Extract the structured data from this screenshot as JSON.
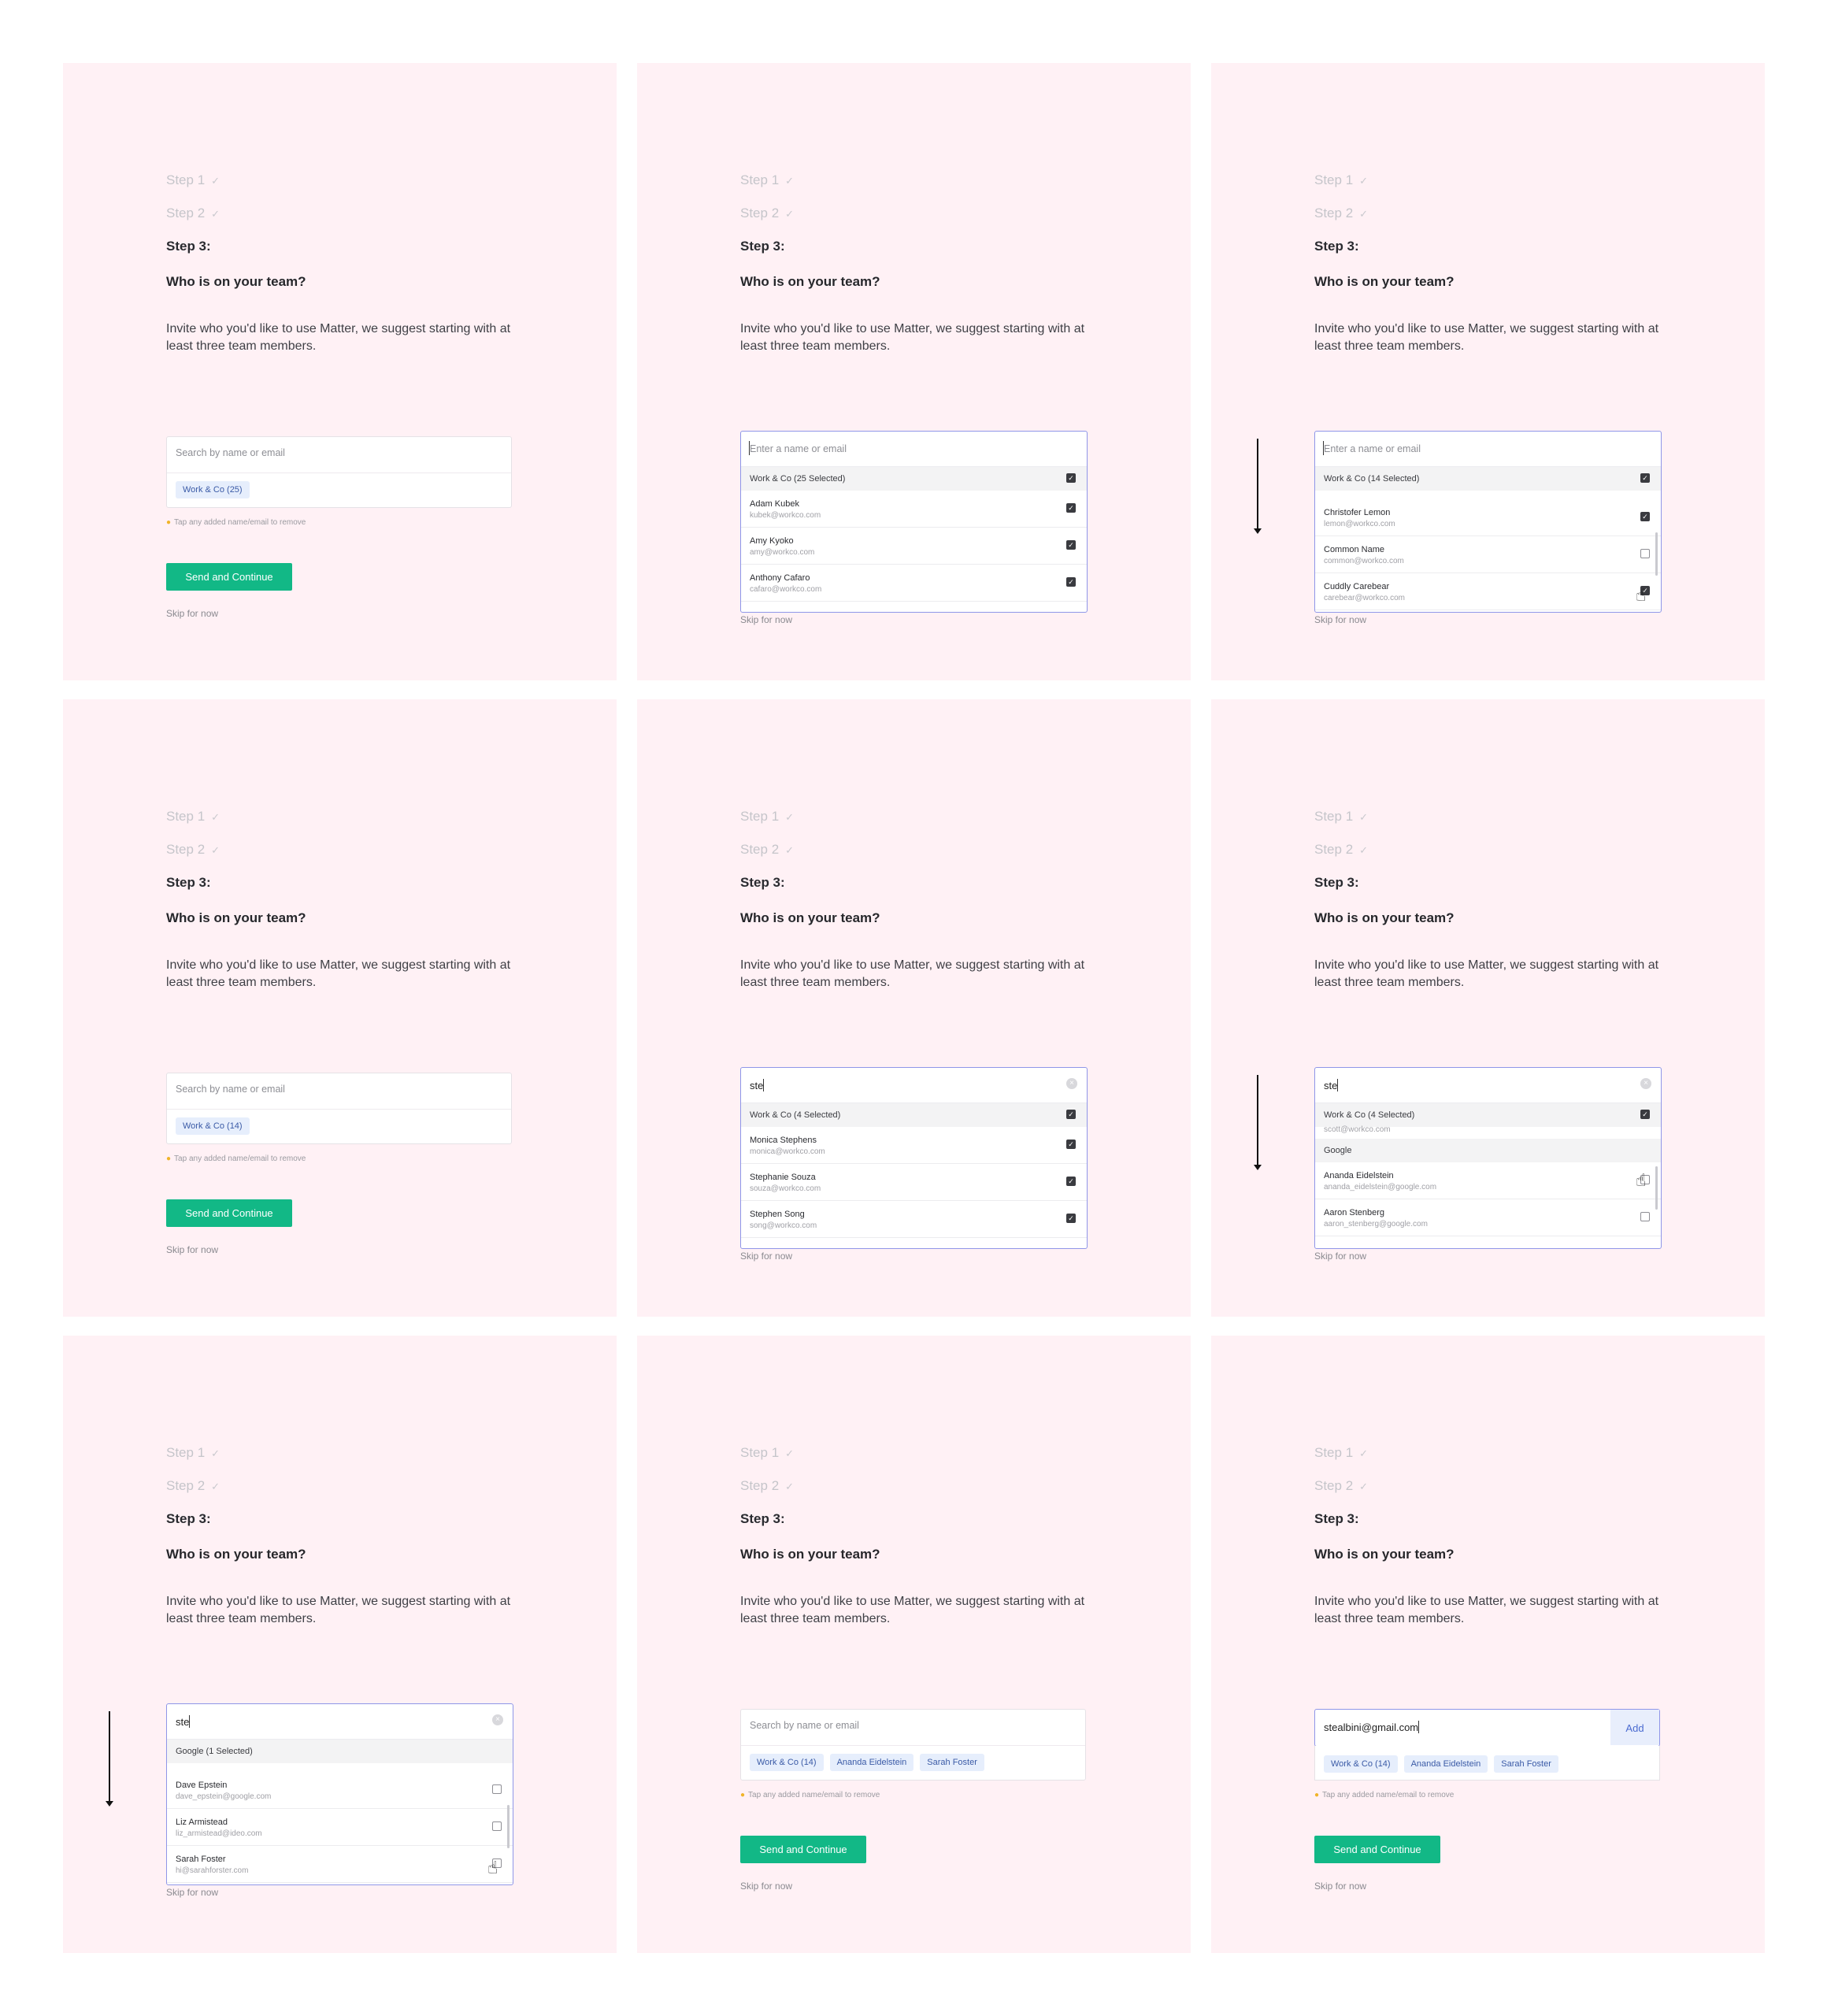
{
  "common": {
    "step1": "Step 1",
    "step2": "Step 2",
    "step3": "Step 3:",
    "check": "✓",
    "question": "Who is on your team?",
    "description": "Invite who you'd like to use Matter, we suggest starting with at least three team members.",
    "search_placeholder": "Search by name or email",
    "dropdown_placeholder": "Enter a name or email",
    "hint": "Tap any added name/email to remove",
    "send_button": "Send and Continue",
    "skip_link": "Skip for now",
    "typed_query": "ste",
    "add_button": "Add",
    "typed_email": "stealbini@gmail.com"
  },
  "panels": {
    "p1": {
      "chips": [
        "Work & Co (25)"
      ]
    },
    "p2": {
      "group": "Work & Co (25 Selected)",
      "options": [
        {
          "name": "Adam Kubek",
          "email": "kubek@workco.com",
          "checked": true
        },
        {
          "name": "Amy Kyoko",
          "email": "amy@workco.com",
          "checked": true
        },
        {
          "name": "Anthony Cafaro",
          "email": "cafaro@workco.com",
          "checked": true
        }
      ]
    },
    "p3": {
      "group": "Work & Co (14 Selected)",
      "options": [
        {
          "name": "Christofer Lemon",
          "email": "lemon@workco.com",
          "checked": true
        },
        {
          "name": "Common Name",
          "email": "common@workco.com",
          "checked": false
        },
        {
          "name": "Cuddly Carebear",
          "email": "carebear@workco.com",
          "checked": true
        }
      ]
    },
    "p4": {
      "chips": [
        "Work & Co (14)"
      ]
    },
    "p5": {
      "group": "Work & Co (4 Selected)",
      "options": [
        {
          "name": "Monica Stephens",
          "email": "monica@workco.com",
          "checked": true
        },
        {
          "name": "Stephanie Souza",
          "email": "souza@workco.com",
          "checked": true
        },
        {
          "name": "Stephen Song",
          "email": "song@workco.com",
          "checked": true
        }
      ]
    },
    "p6": {
      "group": "Work & Co (4 Selected)",
      "partial_email": "scott@workco.com",
      "subgroup": "Google",
      "options": [
        {
          "name": "Ananda Eidelstein",
          "email": "ananda_eidelstein@google.com",
          "checked": false
        },
        {
          "name": "Aaron Stenberg",
          "email": "aaron_stenberg@google.com",
          "checked": false
        }
      ]
    },
    "p7": {
      "group": "Google (1 Selected)",
      "options": [
        {
          "name": "Dave Epstein",
          "email": "dave_epstein@google.com",
          "checked": false
        },
        {
          "name": "Liz Armistead",
          "email": "liz_armistead@ideo.com",
          "checked": false
        },
        {
          "name": "Sarah Foster",
          "email": "hi@sarahforster.com",
          "checked": false
        }
      ]
    },
    "p8": {
      "chips": [
        "Work & Co (14)",
        "Ananda Eidelstein",
        "Sarah Foster"
      ]
    },
    "p9": {
      "chips": [
        "Work & Co (14)",
        "Ananda Eidelstein",
        "Sarah Foster"
      ]
    }
  },
  "colors": {
    "panel_bg": "#fff1f5",
    "accent_green": "#12b886",
    "focus_border": "#8f96e8",
    "chip_bg": "#e6eefc",
    "chip_text": "#3a5aa6"
  },
  "icons": [
    "check-icon",
    "checkbox-checked-icon",
    "checkbox-empty-icon",
    "clear-icon",
    "hand-cursor-icon",
    "lightbulb-icon",
    "scroll-arrow-icon"
  ]
}
